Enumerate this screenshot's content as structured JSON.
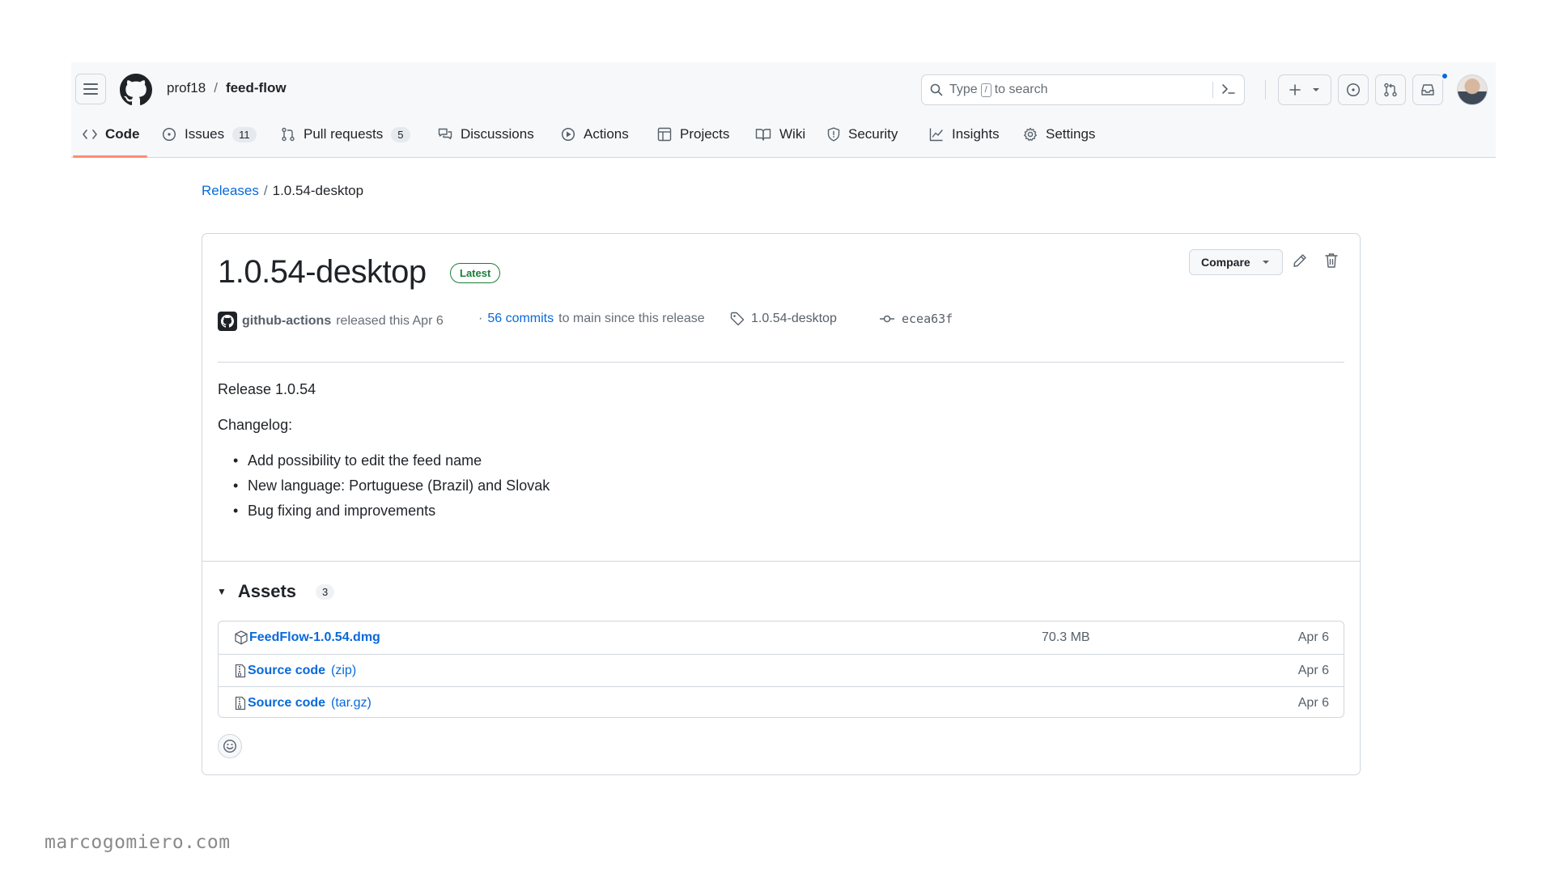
{
  "header": {
    "owner": "prof18",
    "separator": "/",
    "repo": "feed-flow",
    "search": {
      "prefix": "Type",
      "slash": "/",
      "suffix": "to search"
    }
  },
  "tabs": [
    {
      "label": "Code",
      "icon": "code-icon",
      "active": true
    },
    {
      "label": "Issues",
      "icon": "issue-opened-icon",
      "count": "11"
    },
    {
      "label": "Pull requests",
      "icon": "git-pull-request-icon",
      "count": "5"
    },
    {
      "label": "Discussions",
      "icon": "comment-discussion-icon"
    },
    {
      "label": "Actions",
      "icon": "play-icon"
    },
    {
      "label": "Projects",
      "icon": "table-icon"
    },
    {
      "label": "Wiki",
      "icon": "book-icon"
    },
    {
      "label": "Security",
      "icon": "shield-icon"
    },
    {
      "label": "Insights",
      "icon": "graph-icon"
    },
    {
      "label": "Settings",
      "icon": "gear-icon"
    }
  ],
  "breadcrumb": {
    "link": "Releases",
    "sep": "/",
    "current": "1.0.54-desktop"
  },
  "release": {
    "title": "1.0.54-desktop",
    "badge": "Latest",
    "compare_label": "Compare",
    "author": "github-actions",
    "released_text": "released this Apr 6",
    "commits_dot": "·",
    "commits_link": "56 commits",
    "commits_suffix": "to main since this release",
    "tag": "1.0.54-desktop",
    "commit": "ecea63f",
    "body": {
      "heading": "Release 1.0.54",
      "changelog_label": "Changelog:",
      "items": [
        "Add possibility to edit the feed name",
        "New language: Portuguese (Brazil) and Slovak",
        "Bug fixing and improvements"
      ]
    },
    "assets": {
      "label": "Assets",
      "count": "3",
      "rows": [
        {
          "name": "FeedFlow-1.0.54.dmg",
          "ext": "",
          "size": "70.3 MB",
          "date": "Apr 6",
          "icon": "package-icon"
        },
        {
          "name": "Source code",
          "ext": "(zip)",
          "size": "",
          "date": "Apr 6",
          "icon": "file-zip-icon"
        },
        {
          "name": "Source code",
          "ext": "(tar.gz)",
          "size": "",
          "date": "Apr 6",
          "icon": "file-zip-icon"
        }
      ]
    }
  },
  "watermark": "marcogomiero.com",
  "colors": {
    "link": "#0969da",
    "latest": "#1a7f37",
    "active_tab_underline": "#fd8c73",
    "notification_dot": "#0969da"
  }
}
